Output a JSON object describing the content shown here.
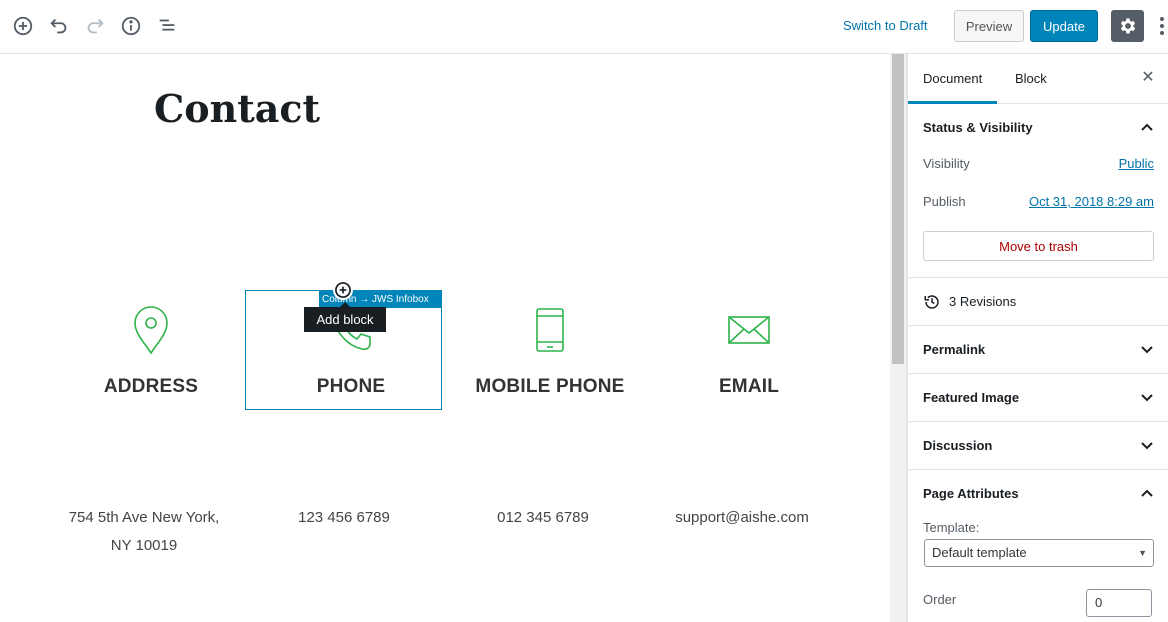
{
  "toolbar": {
    "switch_to_draft": "Switch to Draft",
    "preview": "Preview",
    "update": "Update",
    "icons": [
      "add-block-icon",
      "undo-icon",
      "redo-icon",
      "info-icon",
      "outline-icon",
      "gear-icon",
      "more-icon"
    ]
  },
  "editor": {
    "title": "Contact",
    "selected_block_label": "Column → JWS Infobox",
    "tooltip": "Add block",
    "columns": [
      {
        "heading": "ADDRESS",
        "icon": "map-pin-icon",
        "body_line1": "754 5th Ave New York,",
        "body_line2": "NY 10019"
      },
      {
        "heading": "PHONE",
        "icon": "phone-icon",
        "body_line1": "123 456 6789",
        "body_line2": ""
      },
      {
        "heading": "MOBILE PHONE",
        "icon": "mobile-phone-icon",
        "body_line1": "012 345 6789",
        "body_line2": ""
      },
      {
        "heading": "EMAIL",
        "icon": "envelope-icon",
        "body_line1": "support@aishe.com",
        "body_line2": ""
      }
    ],
    "accent_color": "#2db34a"
  },
  "sidebar": {
    "tabs": [
      {
        "label": "Document"
      },
      {
        "label": "Block"
      }
    ],
    "status_visibility": {
      "title": "Status & Visibility",
      "visibility_label": "Visibility",
      "visibility_value": "Public",
      "publish_label": "Publish",
      "publish_value": "Oct 31, 2018 8:29 am",
      "trash": "Move to trash"
    },
    "revisions": "3 Revisions",
    "panels": [
      {
        "title": "Permalink"
      },
      {
        "title": "Featured Image"
      },
      {
        "title": "Discussion"
      }
    ],
    "page_attributes": {
      "title": "Page Attributes",
      "template_label": "Template:",
      "template_value": "Default template",
      "order_label": "Order",
      "order_value": "0"
    }
  },
  "colors": {
    "primary": "#0085ba",
    "link": "#0073aa",
    "danger": "#a00"
  }
}
